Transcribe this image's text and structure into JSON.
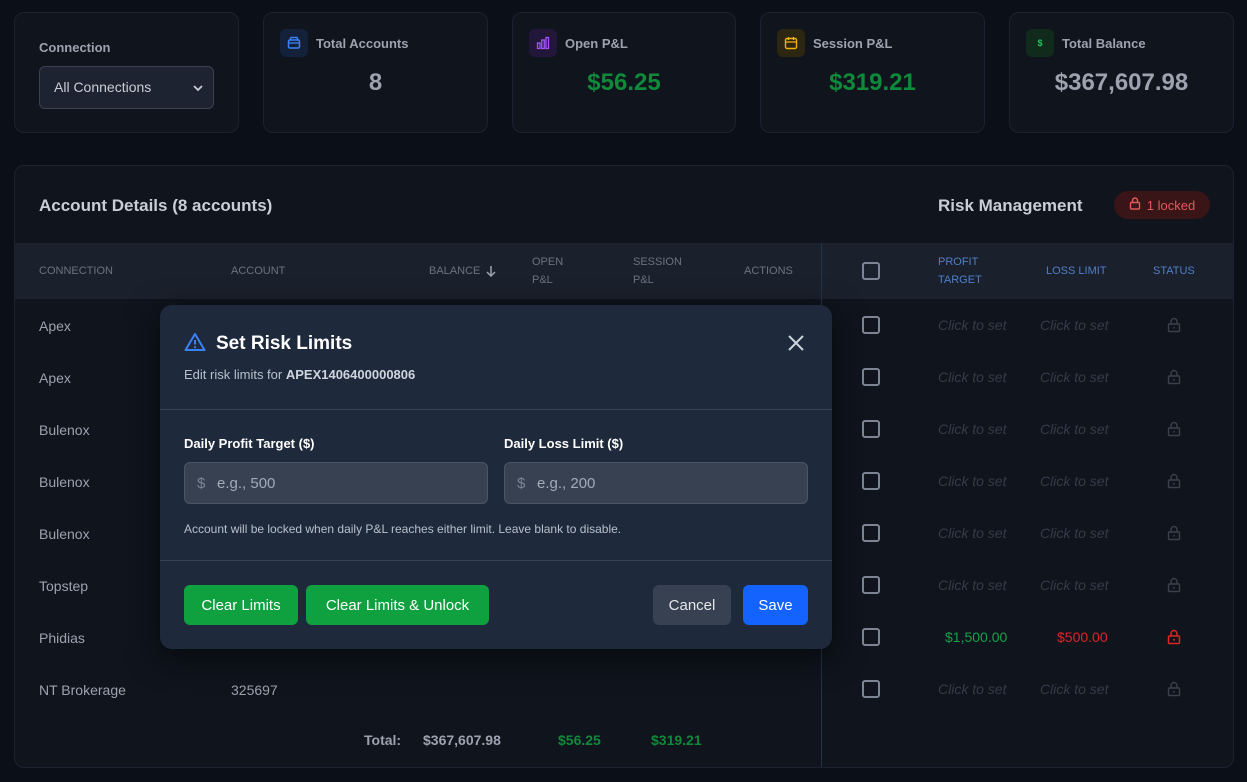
{
  "stats": {
    "connection": {
      "label": "Connection",
      "selected": "All Connections"
    },
    "cards": [
      {
        "title": "Total Accounts",
        "value": "8",
        "icon": "wallet-icon",
        "accent": "#3b82f6"
      },
      {
        "title": "Open P&L",
        "value": "$56.25",
        "icon": "bar-chart-icon",
        "accent": "#a855f7"
      },
      {
        "title": "Session P&L",
        "value": "$319.21",
        "icon": "calendar-icon",
        "accent": "#eab308"
      },
      {
        "title": "Total Balance",
        "value": "$367,607.98",
        "icon": "dollar-icon",
        "accent": "#22c55e"
      }
    ]
  },
  "panel": {
    "title": "Account Details (8 accounts)",
    "risk_title": "Risk Management",
    "locked_badge": "1 locked",
    "columns": [
      "CONNECTION",
      "ACCOUNT",
      "BALANCE",
      "OPEN P&L",
      "SESSION P&L",
      "ACTIONS"
    ],
    "columns_display": {
      "connection": "CONNECTION",
      "account": "ACCOUNT",
      "balance": "BALANCE",
      "open_pnl_1": "OPEN",
      "open_pnl_2": "P&L",
      "session_pnl_1": "SESSION",
      "session_pnl_2": "P&L",
      "actions": "ACTIONS"
    },
    "risk_columns_display": {
      "profit_target_1": "PROFIT",
      "profit_target_2": "TARGET",
      "loss_limit": "LOSS LIMIT",
      "status": "STATUS"
    },
    "rows": [
      {
        "connection": "Apex",
        "account": "",
        "profit_target": "Click to set",
        "loss_limit": "Click to set",
        "locked": false
      },
      {
        "connection": "Apex",
        "account": "",
        "profit_target": "Click to set",
        "loss_limit": "Click to set",
        "locked": false
      },
      {
        "connection": "Bulenox",
        "account": "",
        "profit_target": "Click to set",
        "loss_limit": "Click to set",
        "locked": false
      },
      {
        "connection": "Bulenox",
        "account": "",
        "profit_target": "Click to set",
        "loss_limit": "Click to set",
        "locked": false
      },
      {
        "connection": "Bulenox",
        "account": "",
        "profit_target": "Click to set",
        "loss_limit": "Click to set",
        "locked": false
      },
      {
        "connection": "Topstep",
        "account": "",
        "profit_target": "Click to set",
        "loss_limit": "Click to set",
        "locked": false
      },
      {
        "connection": "Phidias",
        "account": "",
        "profit_target": "$1,500.00",
        "loss_limit": "$500.00",
        "locked": true
      },
      {
        "connection": "NT Brokerage",
        "account": "325697",
        "profit_target": "Click to set",
        "loss_limit": "Click to set",
        "locked": false
      }
    ],
    "totals": {
      "label": "Total:",
      "balance": "$367,607.98",
      "open_pnl": "$56.25",
      "session_pnl": "$319.21"
    }
  },
  "modal": {
    "title": "Set Risk Limits",
    "subtitle_prefix": "Edit risk limits for ",
    "account_id": "APEX1406400000806",
    "profit_label": "Daily Profit Target ($)",
    "profit_placeholder": "e.g., 500",
    "loss_label": "Daily Loss Limit ($)",
    "loss_placeholder": "e.g., 200",
    "currency_symbol": "$",
    "hint": "Account will be locked when daily P&L reaches either limit. Leave blank to disable.",
    "buttons": {
      "clear": "Clear Limits",
      "clear_unlock": "Clear Limits & Unlock",
      "cancel": "Cancel",
      "save": "Save"
    }
  },
  "colors": {
    "positive": "#16a34a",
    "negative": "#dc2626",
    "accent_blue": "#1463ff",
    "green_button": "#0fa040"
  }
}
